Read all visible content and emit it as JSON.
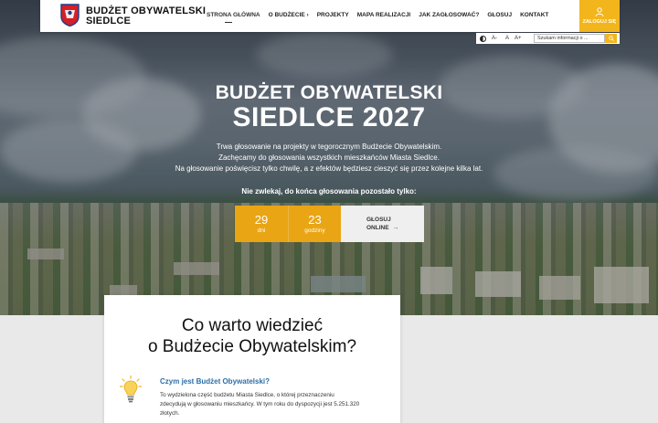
{
  "brand": {
    "line1": "BUDŻET OBYWATELSKI",
    "line2": "SIEDLCE"
  },
  "nav": [
    {
      "label": "STRONA GŁÓWNA"
    },
    {
      "label": "O BUDŻECIE ›"
    },
    {
      "label": "PROJEKTY"
    },
    {
      "label": "MAPA REALIZACJI"
    },
    {
      "label": "JAK ZAGŁOSOWAĆ?"
    },
    {
      "label": "GŁOSUJ"
    },
    {
      "label": "KONTAKT"
    }
  ],
  "login_label": "ZALOGUJ SIĘ",
  "accessibility": {
    "font_smaller": "A-",
    "font_normal": "A",
    "font_larger": "A+"
  },
  "search": {
    "placeholder": "Szukam informacji o ..."
  },
  "hero": {
    "title_line1": "BUDŻET OBYWATELSKI",
    "title_line2": "SIEDLCE 2027",
    "lead_line1": "Trwa głosowanie na projekty w tegorocznym Budżecie Obywatelskim.",
    "lead_line2": "Zachęcamy do głosowania wszystkich mieszkańców Miasta Siedlce.",
    "lead_line3": "Na głosowanie poświęcisz tylko chwilę, a z efektów będziesz cieszyć się przez kolejne kilka lat.",
    "countdown_label": "Nie zwlekaj, do końca głosowania pozostało tylko:"
  },
  "countdown": {
    "days_value": "29",
    "days_unit": "dni",
    "hours_value": "23",
    "hours_unit": "godziny",
    "vote_line1": "GŁOSUJ",
    "vote_line2": "ONLINE"
  },
  "info": {
    "heading_line1": "Co warto wiedzieć",
    "heading_line2": "o Budżecie Obywatelskim?",
    "question": "Czym jest Budżet Obywatelski?",
    "answer": "To wydzielona część budżetu Miasta Siedlce, o której przeznaczeniu zdecydują w głosowaniu mieszkańcy. W tym roku do dyspozycji jest 5.251.320 złotych."
  },
  "colors": {
    "accent": "#f3b51c",
    "countdown": "#e9a514",
    "link": "#2c6fa8"
  }
}
